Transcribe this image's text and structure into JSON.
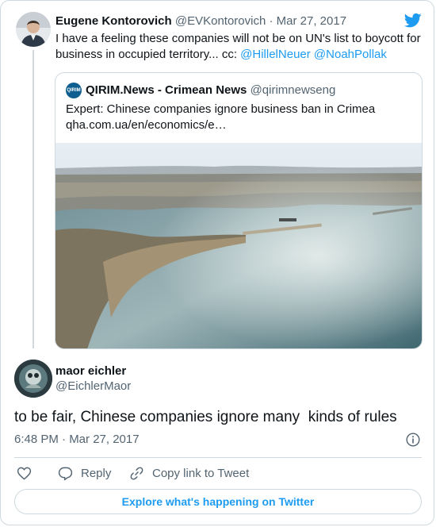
{
  "colors": {
    "accent": "#1d9bf0",
    "text": "#0f1419",
    "muted": "#536471",
    "border": "#cfd9de"
  },
  "parent_tweet": {
    "author_name": "Eugene Kontorovich",
    "author_handle": "@EVKontorovich",
    "separator": " · ",
    "date": "Mar 27, 2017",
    "text_prefix": "I have a feeling these companies will not be on UN's list to boycott for business in occupied territory... cc: ",
    "mention_1": "@HillelNeuer",
    "mention_2": "@NoahPollak"
  },
  "quoted_tweet": {
    "author_name": "QIRIM.News - Crimean News",
    "author_handle": "@qirimnewseng",
    "text_line_1": "Expert: Chinese companies ignore business ban in Crimea",
    "text_line_2": "qha.com.ua/en/economics/e…",
    "avatar_label": "QIRIM"
  },
  "reply_tweet": {
    "author_name": "maor eichler",
    "author_handle": "@EichlerMaor",
    "text": "to be fair, Chinese companies ignore many  kinds of rules",
    "timestamp": "6:48 PM · Mar 27, 2017"
  },
  "actions": {
    "like_icon": "heart-icon",
    "reply_label": "Reply",
    "copy_label": "Copy link to Tweet"
  },
  "explore_label": "Explore what's happening on Twitter"
}
